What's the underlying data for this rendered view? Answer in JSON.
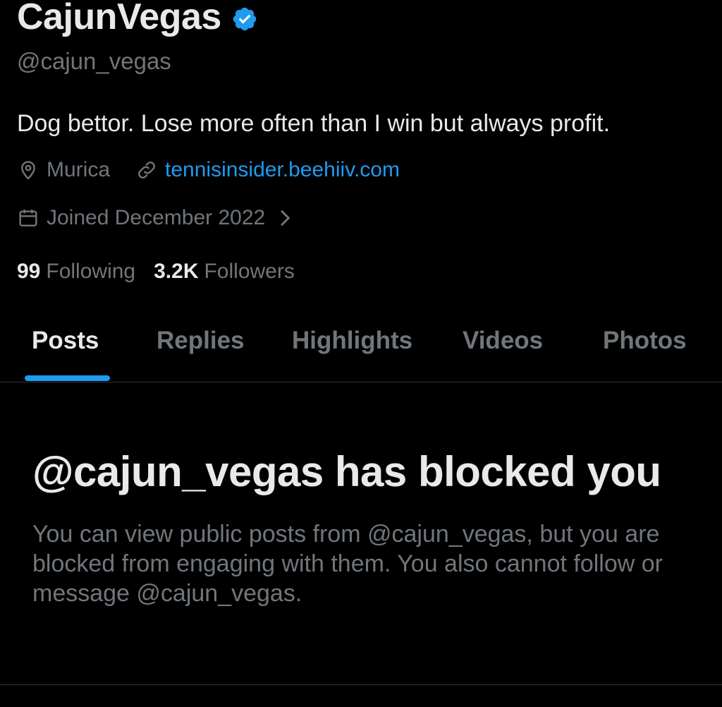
{
  "profile": {
    "display_name": "CajunVegas",
    "handle": "@cajun_vegas",
    "bio": "Dog bettor. Lose more often than I win but always profit.",
    "location": "Murica",
    "website": "tennisinsider.beehiiv.com",
    "joined": "Joined December 2022",
    "following_count": "99",
    "following_label": "Following",
    "followers_count": "3.2K",
    "followers_label": "Followers"
  },
  "tabs": [
    {
      "label": "Posts",
      "active": true
    },
    {
      "label": "Replies",
      "active": false
    },
    {
      "label": "Highlights",
      "active": false
    },
    {
      "label": "Videos",
      "active": false
    },
    {
      "label": "Photos",
      "active": false
    }
  ],
  "blocked": {
    "title": "@cajun_vegas has blocked you",
    "description": "You can view public posts from @cajun_vegas, but you are blocked from engaging with them. You also cannot follow or message @cajun_vegas."
  },
  "icons": {
    "verified": "verified-badge-icon",
    "location": "location-pin-icon",
    "link": "link-icon",
    "calendar": "calendar-icon",
    "chevron": "chevron-right-icon"
  },
  "colors": {
    "background": "#000000",
    "text_primary": "#e7e9ea",
    "text_secondary": "#71767b",
    "accent": "#1d9bf0"
  }
}
